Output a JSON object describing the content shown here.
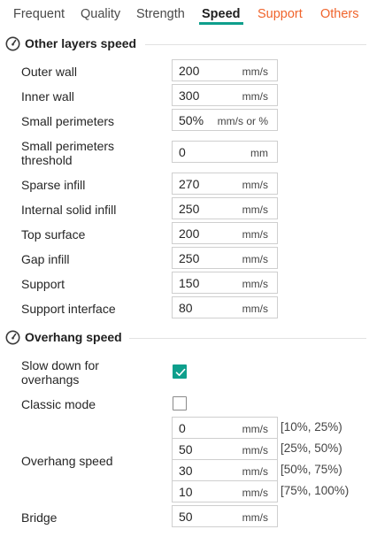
{
  "tabs": [
    {
      "label": "Frequent"
    },
    {
      "label": "Quality"
    },
    {
      "label": "Strength"
    },
    {
      "label": "Speed"
    },
    {
      "label": "Support"
    },
    {
      "label": "Others"
    }
  ],
  "colors": {
    "accent": "#0e9f8c",
    "tab_highlight": "#f0642c"
  },
  "sections": {
    "other_layers": {
      "title": "Other layers speed",
      "icon": "gauge-icon",
      "rows": [
        {
          "label": "Outer wall",
          "value": "200",
          "unit": "mm/s"
        },
        {
          "label": "Inner wall",
          "value": "300",
          "unit": "mm/s"
        },
        {
          "label": "Small perimeters",
          "value": "50%",
          "unit": "mm/s or %"
        },
        {
          "label_line1": "Small perimeters",
          "label_line2": "threshold",
          "value": "0",
          "unit": "mm"
        },
        {
          "label": "Sparse infill",
          "value": "270",
          "unit": "mm/s"
        },
        {
          "label": "Internal solid infill",
          "value": "250",
          "unit": "mm/s"
        },
        {
          "label": "Top surface",
          "value": "200",
          "unit": "mm/s"
        },
        {
          "label": "Gap infill",
          "value": "250",
          "unit": "mm/s"
        },
        {
          "label": "Support",
          "value": "150",
          "unit": "mm/s"
        },
        {
          "label": "Support interface",
          "value": "80",
          "unit": "mm/s"
        }
      ]
    },
    "overhang": {
      "title": "Overhang speed",
      "icon": "gauge-icon",
      "slow_down": {
        "label_line1": "Slow down for",
        "label_line2": "overhangs",
        "checked": true
      },
      "classic_mode": {
        "label": "Classic mode",
        "checked": false
      },
      "overhang_speed": {
        "label": "Overhang speed",
        "rows": [
          {
            "value": "0",
            "unit": "mm/s",
            "range": "[10%, 25%)"
          },
          {
            "value": "50",
            "unit": "mm/s",
            "range": "[25%, 50%)"
          },
          {
            "value": "30",
            "unit": "mm/s",
            "range": "[50%, 75%)"
          },
          {
            "value": "10",
            "unit": "mm/s",
            "range": "[75%, 100%)"
          }
        ]
      },
      "bridge": {
        "label": "Bridge",
        "value": "50",
        "unit": "mm/s"
      }
    }
  }
}
